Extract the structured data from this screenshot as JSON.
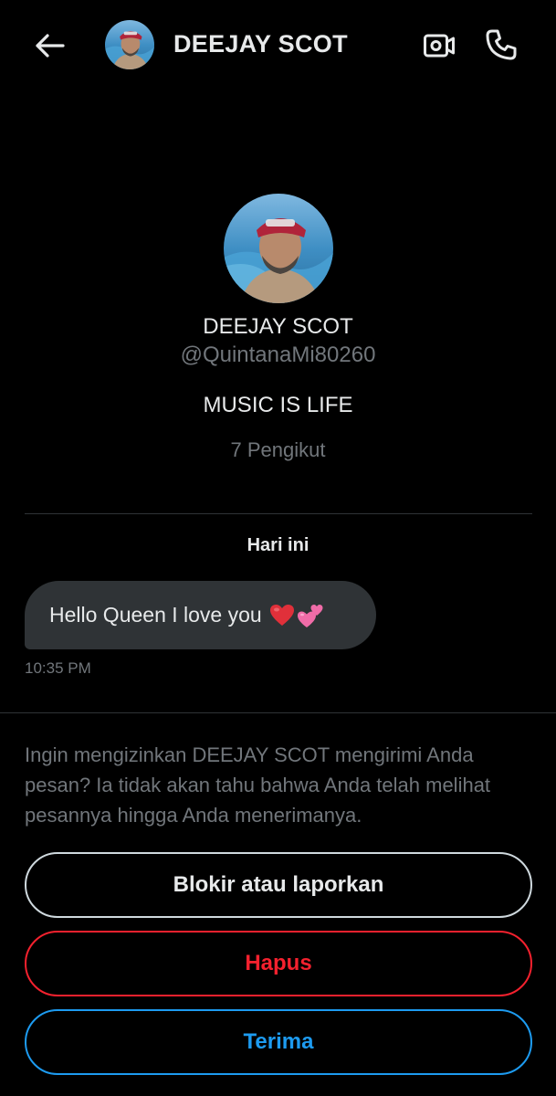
{
  "header": {
    "back_icon": "arrow-left-icon",
    "name": "DEEJAY SCOT",
    "video_icon": "video-camera-icon",
    "call_icon": "phone-icon"
  },
  "profile": {
    "name": "DEEJAY SCOT",
    "handle": "@QuintanaMi80260",
    "bio": "MUSIC IS LIFE",
    "followers": "7 Pengikut"
  },
  "conversation": {
    "date_separator": "Hari ini",
    "messages": [
      {
        "text": "Hello Queen I love you",
        "emoji": [
          "red-heart-icon",
          "two-hearts-icon"
        ],
        "time": "10:35 PM"
      }
    ]
  },
  "request": {
    "prompt": "Ingin mengizinkan DEEJAY SCOT mengirimi Anda pesan? Ia tidak akan tahu bahwa Anda telah melihat pesannya hingga Anda menerimanya.",
    "block_label": "Blokir atau laporkan",
    "delete_label": "Hapus",
    "accept_label": "Terima"
  },
  "colors": {
    "background": "#000000",
    "text_primary": "#e7e9ea",
    "text_secondary": "#71767b",
    "bubble": "#2f3336",
    "danger": "#f4212e",
    "accent": "#1d9bf0"
  }
}
